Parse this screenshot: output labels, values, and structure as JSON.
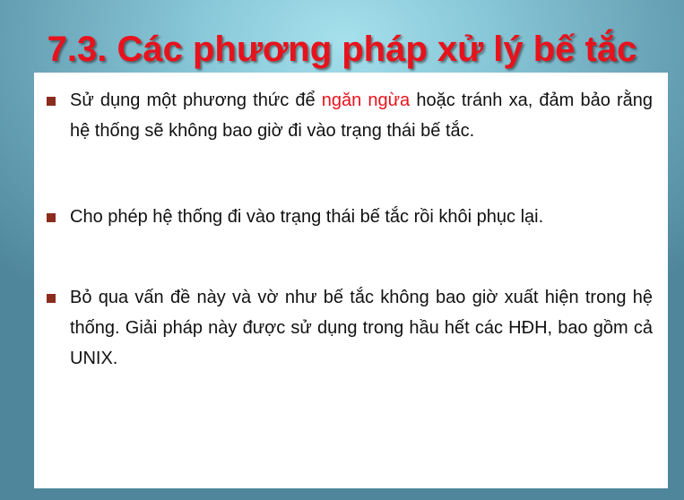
{
  "slide": {
    "title": "7.3. Các phương pháp xử lý bế tắc",
    "bullets": [
      {
        "before": "Sử dụng một phương thức để ",
        "highlight": "ngăn ngừa",
        "after": " hoặc tránh xa, đảm bảo rằng hệ thống sẽ không bao giờ đi vào trạng thái bế tắc."
      },
      {
        "text": "Cho phép hệ thống đi vào trạng thái bế tắc rồi khôi phục lại."
      },
      {
        "text": "Bỏ qua vấn đề này và vờ như bế tắc không bao giờ xuất hiện trong hệ thống. Giải pháp này được sử dụng trong hầu hết các HĐH, bao gồm cả UNIX."
      }
    ]
  },
  "colors": {
    "title": "#e8121c",
    "highlight": "#e8121c",
    "bullet_marker": "#8b2c1e",
    "body_text": "#111111",
    "content_background": "#ffffff"
  }
}
